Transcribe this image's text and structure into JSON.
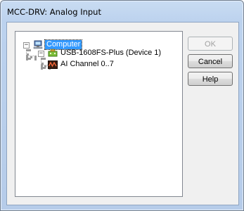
{
  "window": {
    "title": "MCC-DRV: Analog Input"
  },
  "tree": {
    "nodes": [
      {
        "label": "Computer",
        "icon": "computer-icon",
        "expander": "−",
        "selected": true
      },
      {
        "label": "USB-1608FS-Plus (Device 1)",
        "icon": "usb-device-icon",
        "expander": "−",
        "selected": false
      },
      {
        "label": "AI Channel 0..7",
        "icon": "analog-input-icon",
        "selected": false
      }
    ]
  },
  "buttons": {
    "ok": "OK",
    "cancel": "Cancel",
    "help": "Help"
  },
  "colors": {
    "selection": "#3399ff",
    "title_bar": "#bcd2ee"
  }
}
